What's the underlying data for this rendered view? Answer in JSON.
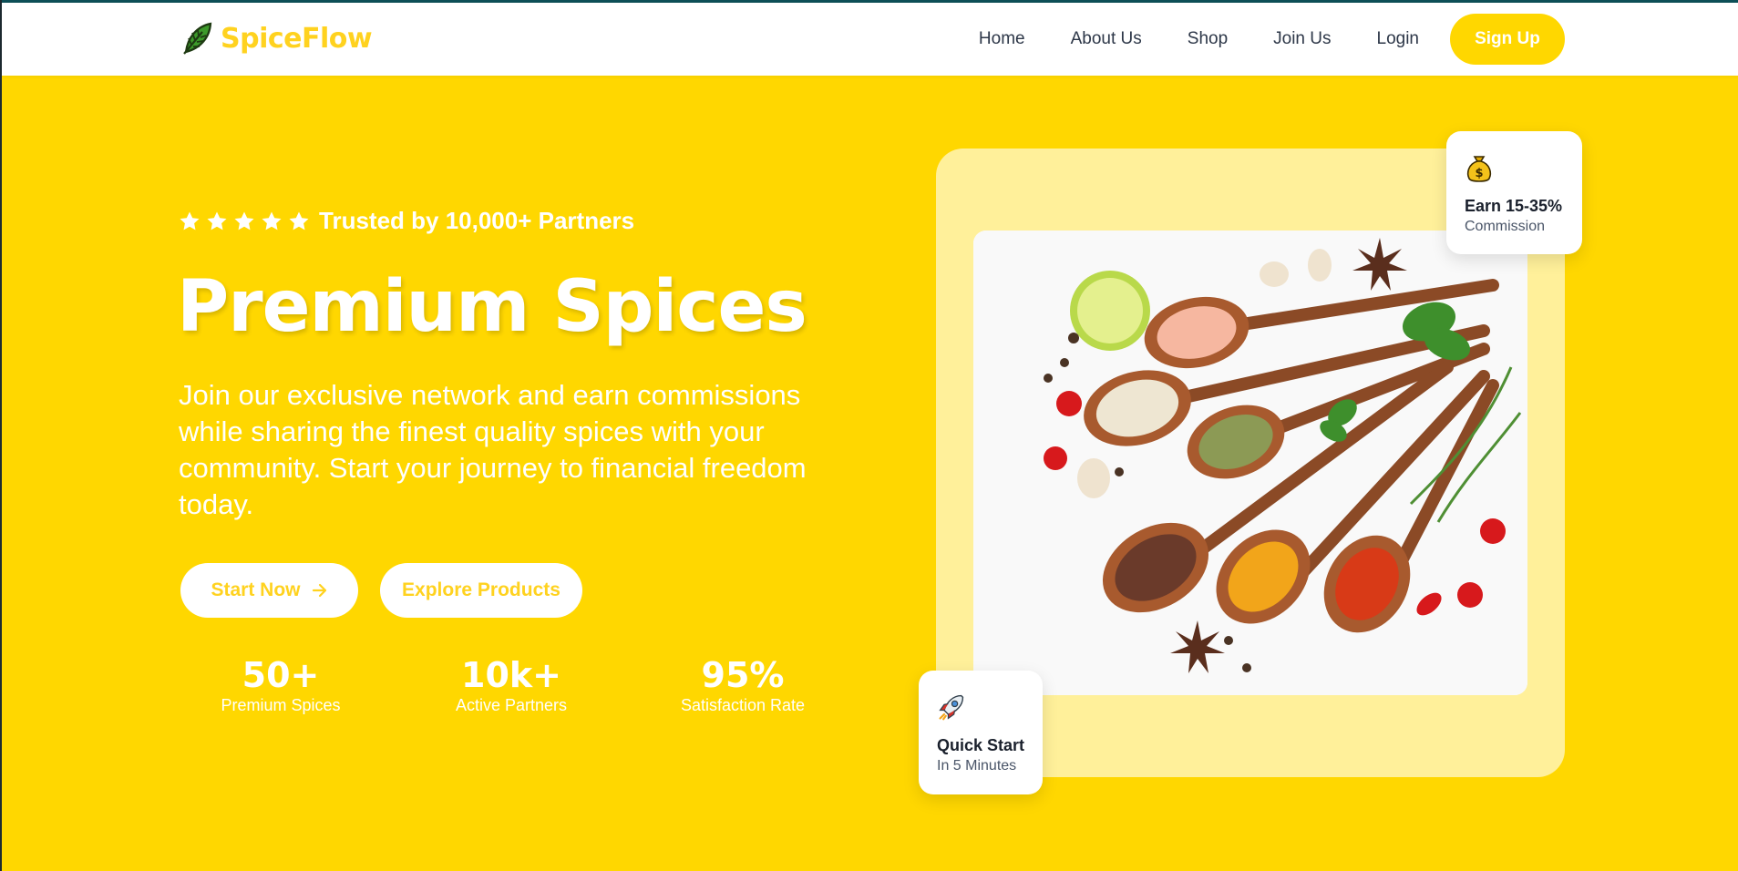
{
  "brand": {
    "name": "SpiceFlow",
    "logo_icon": "leaf-icon",
    "color": "#ffd21f"
  },
  "nav": {
    "links": [
      "Home",
      "About Us",
      "Shop",
      "Join Us",
      "Login"
    ],
    "signup_label": "Sign Up"
  },
  "hero": {
    "rating_stars": 5,
    "trusted_text": "Trusted by 10,000+ Partners",
    "title": "Premium Spices",
    "description": "Join our exclusive network and earn commissions while sharing the finest quality spices with your community. Start your journey to financial freedom today.",
    "start_label": "Start Now",
    "start_icon": "arrow-right-icon",
    "explore_label": "Explore Products",
    "stats": [
      {
        "value": "50+",
        "label": "Premium Spices"
      },
      {
        "value": "10k+",
        "label": "Active Partners"
      },
      {
        "value": "95%",
        "label": "Satisfaction Rate"
      }
    ]
  },
  "cards": {
    "earn": {
      "icon": "money-bag-icon",
      "title": "Earn 15-35%",
      "subtitle": "Commission"
    },
    "quick": {
      "icon": "rocket-icon",
      "title": "Quick Start",
      "subtitle": "In 5 Minutes"
    }
  },
  "colors": {
    "background": "#ffd700",
    "panel": "#fff09a",
    "accent": "#ffd21f",
    "text_dark": "#2d3748"
  }
}
